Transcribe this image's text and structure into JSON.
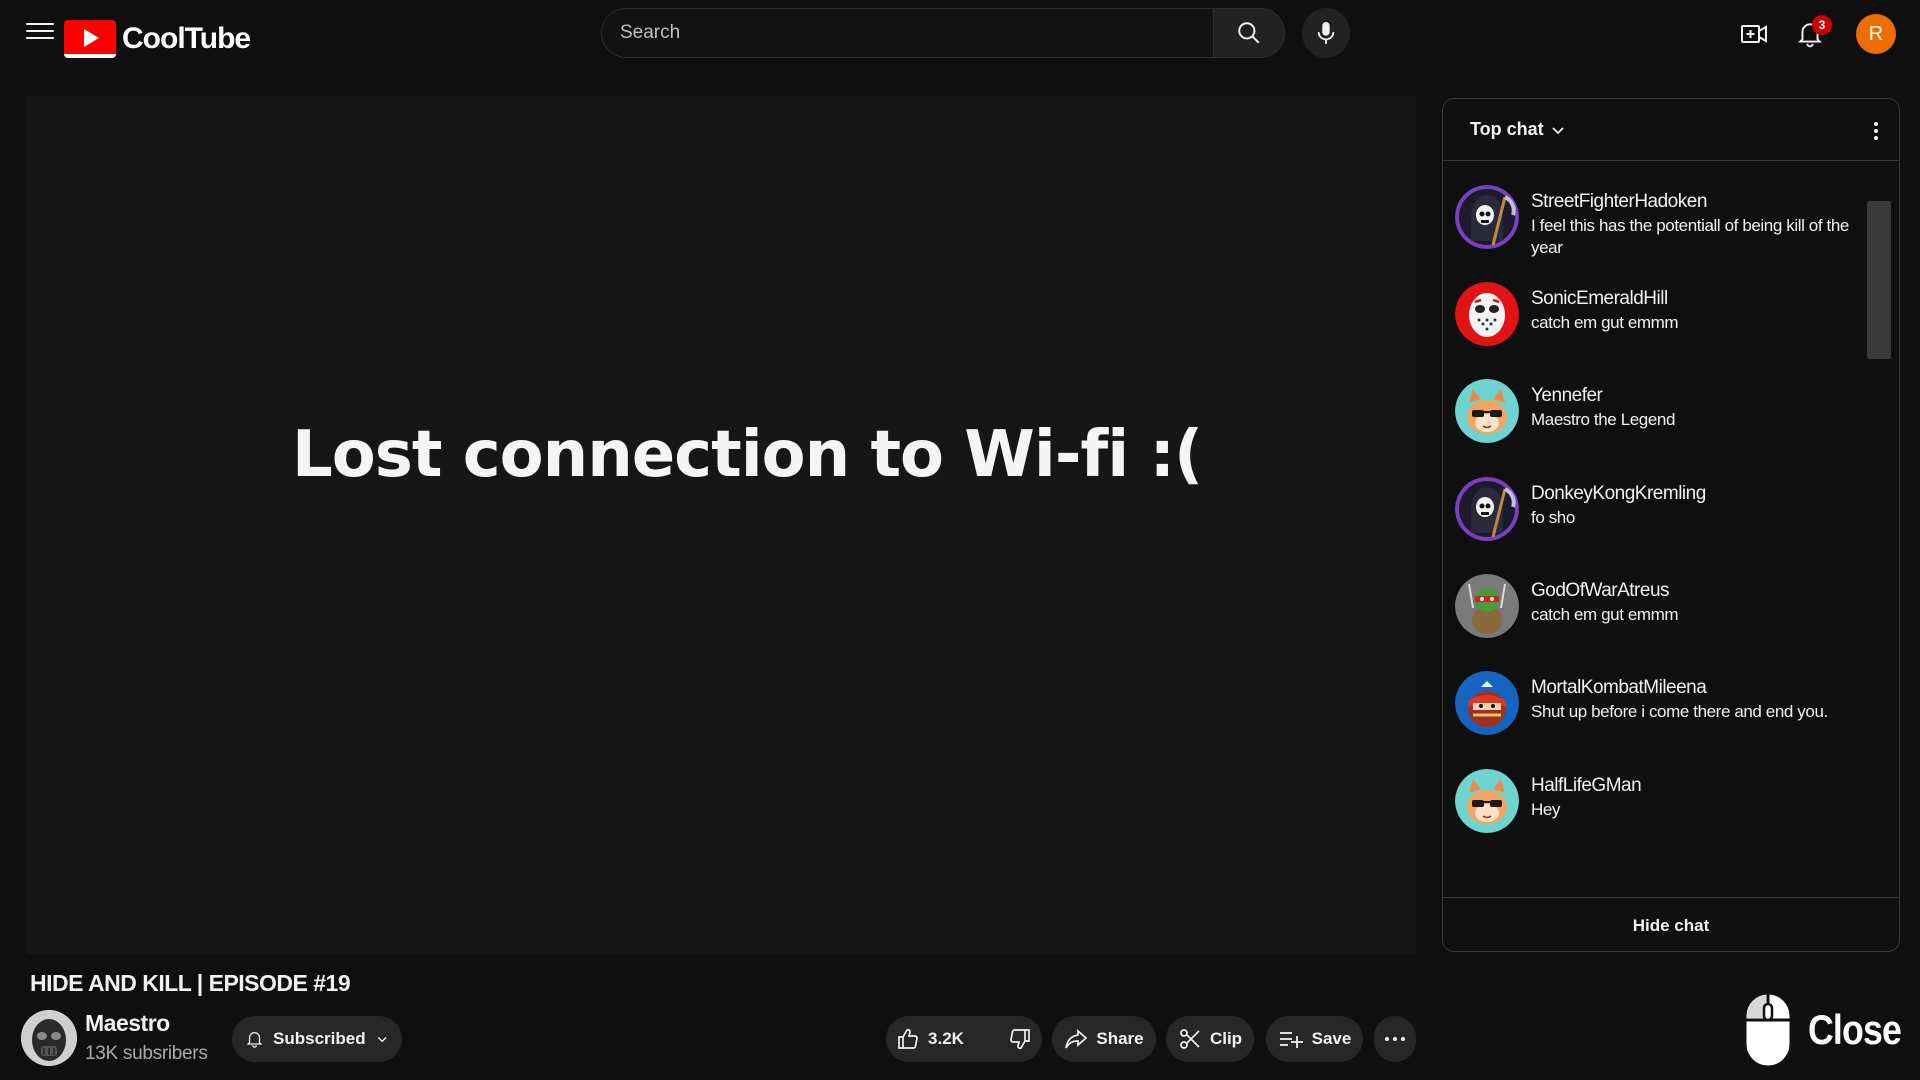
{
  "header": {
    "logo_text": "CoolTube",
    "search_placeholder": "Search",
    "notifications_count": "3",
    "avatar_initial": "R"
  },
  "player": {
    "message": "Lost connection to Wi-fi :("
  },
  "video": {
    "title": "HIDE AND KILL | EPISODE #19",
    "channel_name": "Maestro",
    "channel_subs": "13K subsribers",
    "subscribe_label": "Subscribed",
    "like_count": "3.2K",
    "share_label": "Share",
    "clip_label": "Clip",
    "save_label": "Save"
  },
  "chat": {
    "mode_label": "Top chat",
    "hide_label": "Hide chat",
    "messages": [
      {
        "author": "StreetFighterHadoken",
        "text": "I feel this has the potentiall of being kill of the year",
        "avatar": "reaper"
      },
      {
        "author": "SonicEmeraldHill",
        "text": "catch em gut emmm",
        "avatar": "hockey-mask"
      },
      {
        "author": "Yennefer",
        "text": "Maestro the Legend",
        "avatar": "cat"
      },
      {
        "author": "DonkeyKongKremling",
        "text": "fo sho",
        "avatar": "reaper"
      },
      {
        "author": "GodOfWarAtreus",
        "text": "catch em gut emmm",
        "avatar": "turtle"
      },
      {
        "author": "MortalKombatMileena",
        "text": "Shut up before i come there and end you.",
        "avatar": "ninja"
      },
      {
        "author": "HalfLifeGMan",
        "text": "Hey",
        "avatar": "cat"
      }
    ]
  },
  "overlay": {
    "close_label": "Close"
  },
  "colors": {
    "background": "#0f0f0f",
    "brand_red": "#ff0000",
    "avatar_orange": "#ef6c00",
    "badge_red": "#cc0000"
  }
}
